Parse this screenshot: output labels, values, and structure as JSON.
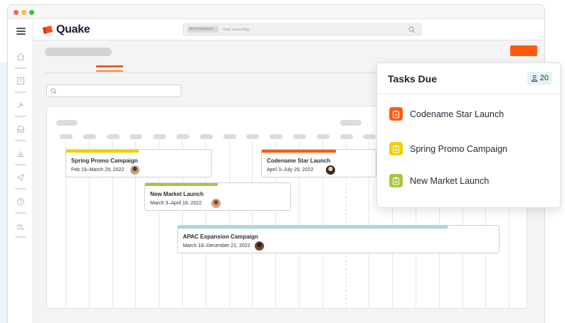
{
  "app": {
    "logo_text": "Quake",
    "search_placeholder": "Start searching...",
    "search_scope": "All workspaces"
  },
  "colors": {
    "brand_orange": "#ff5a10",
    "accent_yellow": "#f2cf00",
    "accent_green": "#a8c83a",
    "accent_teal": "#a8d7dd"
  },
  "gantt": {
    "tasks": [
      {
        "name": "Spring Promo Campaign",
        "dates": "Feb 19–March 29, 2022",
        "color": "#f2cf00",
        "progress": 0.5
      },
      {
        "name": "New Market Launch",
        "dates": "March 3–April 18, 2022",
        "color": "#a8c83a",
        "progress": 0.5
      },
      {
        "name": "Codename Star Launch",
        "dates": "April 3–July 29, 2022",
        "color": "#ff5a10",
        "progress": 0.65
      },
      {
        "name": "APAC Expansion Campaign",
        "dates": "March 18–December 21, 2022",
        "color": "#a8d7dd",
        "progress": 0.84
      }
    ]
  },
  "tasks_due": {
    "title": "Tasks Due",
    "count": "20",
    "items": [
      {
        "label": "Codename Star Launch",
        "color": "#ff5a10"
      },
      {
        "label": "Spring Promo Campaign",
        "color": "#f2cf00"
      },
      {
        "label": "New Market Launch",
        "color": "#a8c83a"
      }
    ]
  },
  "icons": {
    "sidebar": [
      "home-icon",
      "dashboard-icon",
      "tools-icon",
      "inbox-icon",
      "chart-icon",
      "send-icon",
      "support-icon",
      "signature-icon"
    ]
  }
}
